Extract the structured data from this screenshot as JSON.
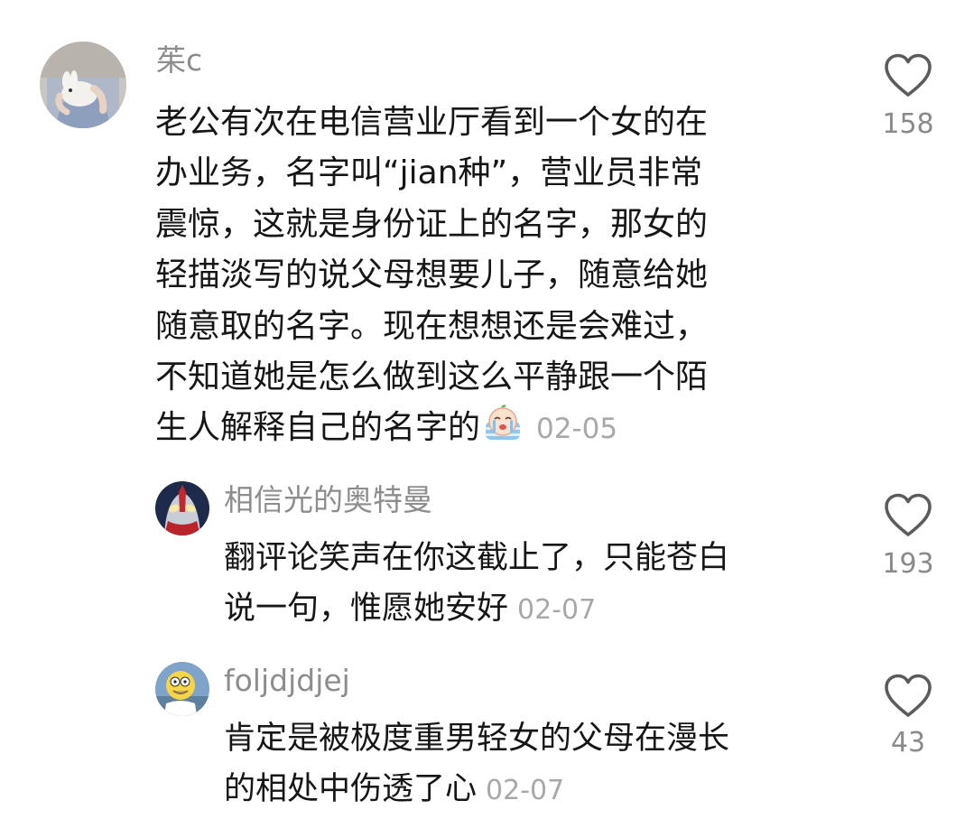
{
  "comments": [
    {
      "username": "茱c",
      "text_lines": [
        "老公有次在电信营业厅看到一个女的在",
        "办业务，名字叫“jian种”，营业员非常",
        "震惊，这就是身份证上的名字，那女的",
        "轻描淡写的说父母想要儿子，随意给她",
        "随意取的名字。现在想想还是会难过，",
        "不知道她是怎么做到这么平静跟一个陌",
        "生人解释自己的名字的"
      ],
      "emoji": "crying-face-emoji",
      "date": "02-05",
      "like_count": "158",
      "avatar": "girl-holding-rabbit-avatar"
    },
    {
      "username": "相信光的奥特曼",
      "text_lines": [
        "翻评论笑声在你这截止了，只能苍白",
        "说一句，惟愿她安好"
      ],
      "date": "02-07",
      "like_count": "193",
      "avatar": "ultraman-avatar"
    },
    {
      "username": "foljdjdjej",
      "text_lines": [
        "肯定是被极度重男轻女的父母在漫长",
        "的相处中伤透了心"
      ],
      "date": "02-07",
      "like_count": "43",
      "avatar": "cartoon-character-avatar"
    }
  ],
  "icons": {
    "like": "heart-outline-icon"
  },
  "colors": {
    "background": "#ffffff",
    "text": "#161616",
    "username": "#8d8d8d",
    "date": "#a8a8a8",
    "like_icon": "#5c5c5c"
  }
}
